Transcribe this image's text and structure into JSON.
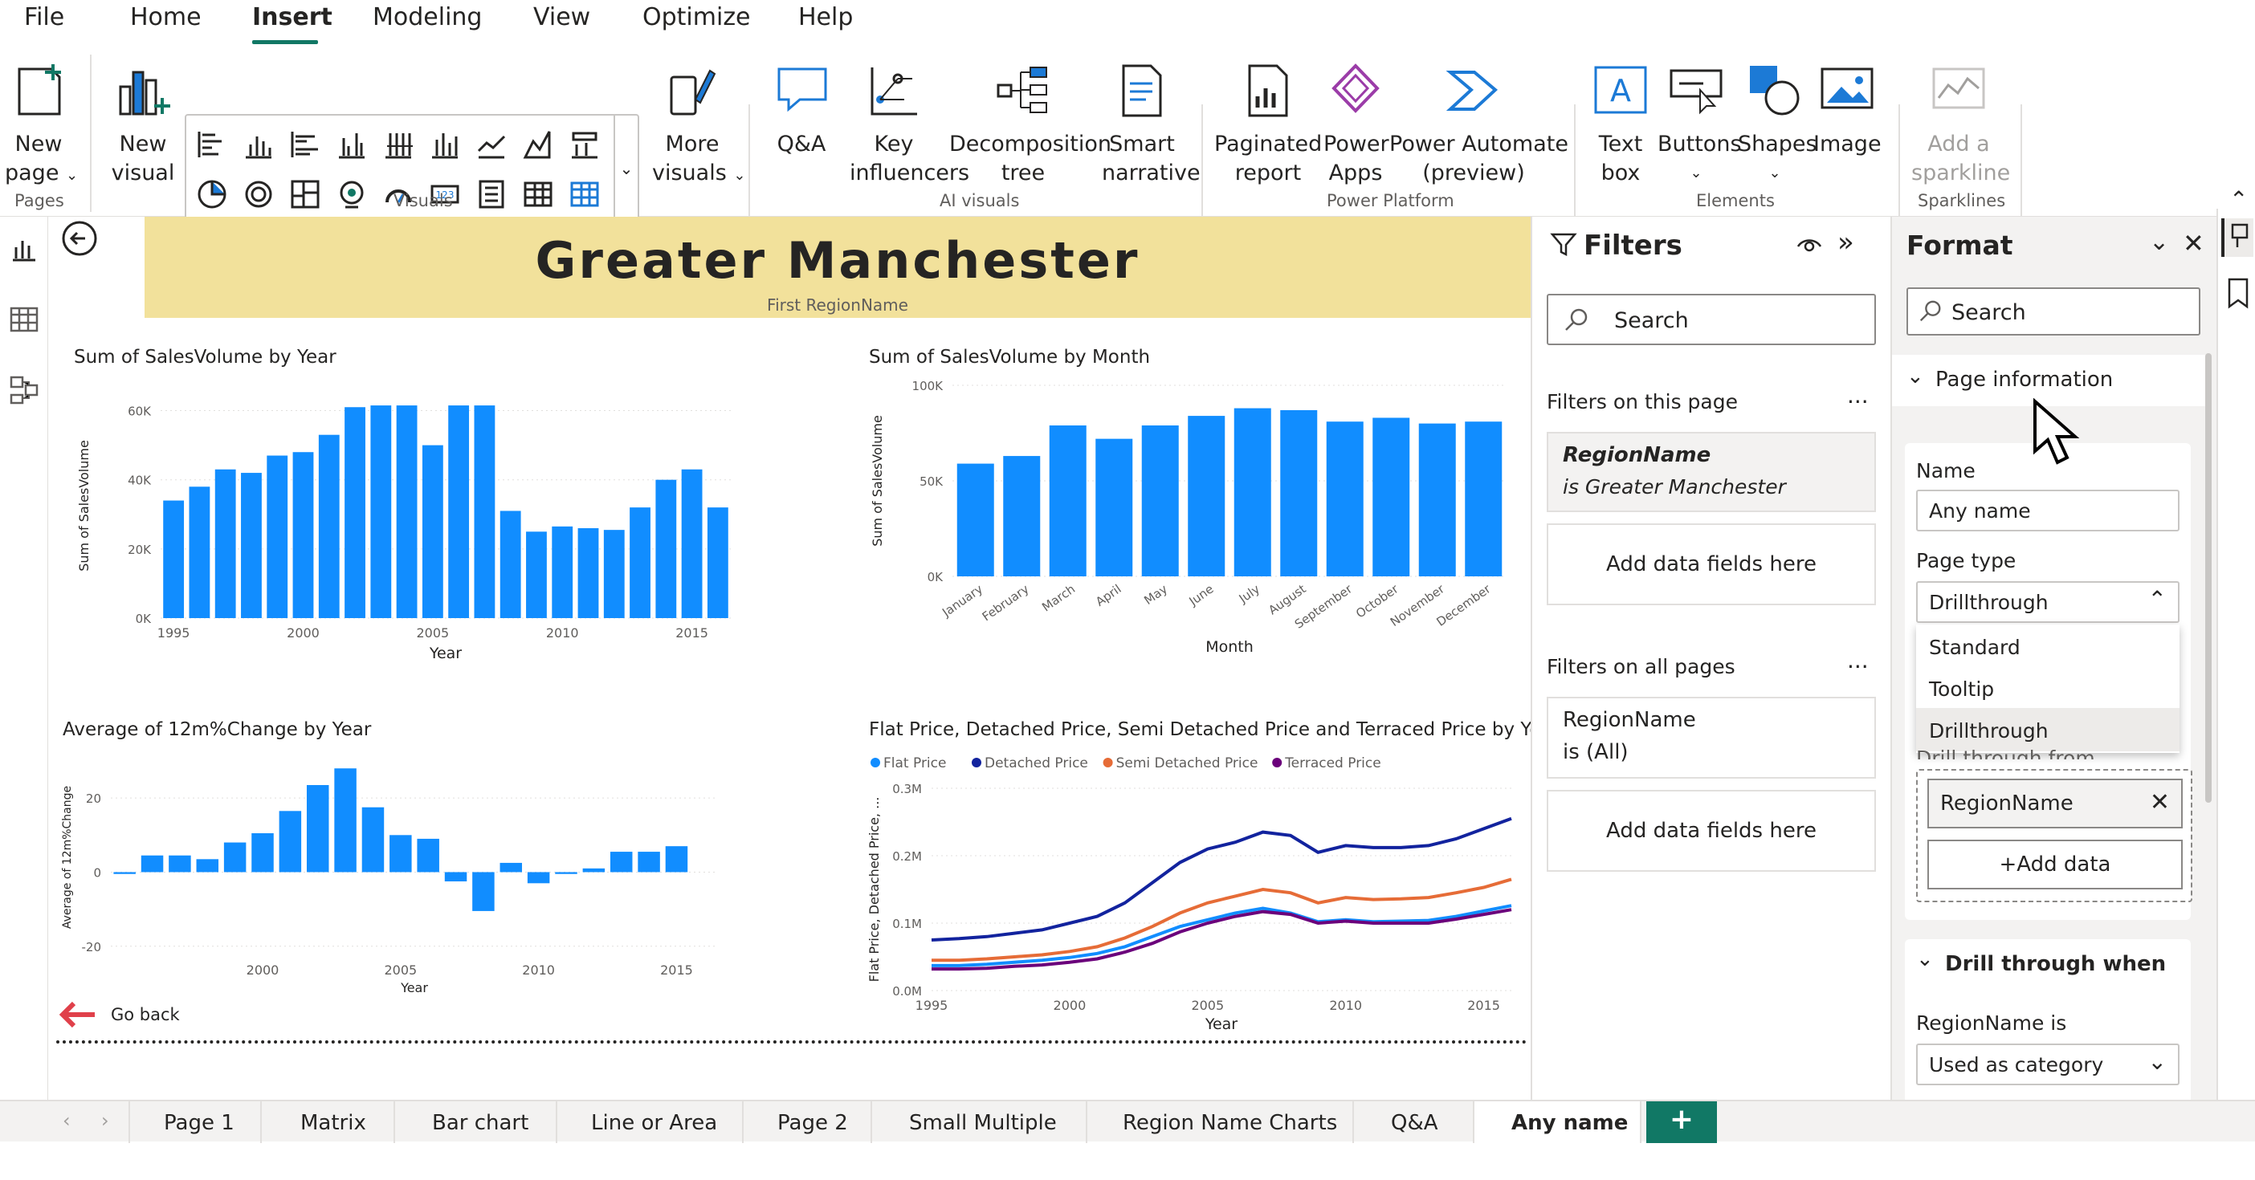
{
  "menu": {
    "items": [
      "File",
      "Home",
      "Insert",
      "Modeling",
      "View",
      "Optimize",
      "Help"
    ],
    "active": "Insert"
  },
  "ribbon": {
    "new_page": {
      "line1": "New",
      "line2": "page"
    },
    "pages_group": "Pages",
    "new_visual": {
      "line1": "New",
      "line2": "visual"
    },
    "visuals_group": "Visuals",
    "more_visuals": {
      "line1": "More",
      "line2": "visuals"
    },
    "qa": "Q&A",
    "key_influencers": {
      "line1": "Key",
      "line2": "influencers"
    },
    "decomp": {
      "line1": "Decomposition",
      "line2": "tree"
    },
    "smart": {
      "line1": "Smart",
      "line2": "narrative"
    },
    "ai_group": "AI visuals",
    "paginated": {
      "line1": "Paginated",
      "line2": "report"
    },
    "power_apps": {
      "line1": "Power",
      "line2": "Apps"
    },
    "power_automate": {
      "line1": "Power Automate",
      "line2": "(preview)"
    },
    "power_group": "Power Platform",
    "text_box": {
      "line1": "Text",
      "line2": "box"
    },
    "buttons": "Buttons",
    "shapes": "Shapes",
    "image": "Image",
    "elements_group": "Elements",
    "sparkline": {
      "line1": "Add a",
      "line2": "sparkline"
    },
    "sparklines_group": "Sparklines"
  },
  "report": {
    "title": "Greater Manchester",
    "subtitle": "First RegionName",
    "go_back": "Go back"
  },
  "chart_data": [
    {
      "type": "bar",
      "title": "Sum of SalesVolume by Year",
      "xlabel": "Year",
      "ylabel": "Sum of SalesVolume",
      "x": [
        1995,
        1996,
        1997,
        1998,
        1999,
        2000,
        2001,
        2002,
        2003,
        2004,
        2005,
        2006,
        2007,
        2008,
        2009,
        2010,
        2011,
        2012,
        2013,
        2014,
        2015,
        2016
      ],
      "values": [
        34000,
        38000,
        43000,
        42000,
        47000,
        48000,
        53000,
        61000,
        61500,
        61500,
        50000,
        61500,
        61500,
        31000,
        25000,
        26500,
        26000,
        25500,
        32000,
        40000,
        43000,
        32000
      ],
      "ylim": [
        0,
        65000
      ],
      "yticks": [
        "0K",
        "20K",
        "40K",
        "60K"
      ],
      "xticks": [
        "1995",
        "2000",
        "2005",
        "2010",
        "2015"
      ],
      "color": "#118dff"
    },
    {
      "type": "bar",
      "title": "Sum of SalesVolume by Month",
      "xlabel": "Month",
      "ylabel": "Sum of SalesVolume",
      "categories": [
        "January",
        "February",
        "March",
        "April",
        "May",
        "June",
        "July",
        "August",
        "September",
        "October",
        "November",
        "December"
      ],
      "values": [
        59000,
        63000,
        79000,
        72000,
        79000,
        84000,
        88000,
        87000,
        81000,
        83000,
        80000,
        81000
      ],
      "ylim": [
        0,
        100000
      ],
      "yticks": [
        "0K",
        "50K",
        "100K"
      ],
      "color": "#118dff"
    },
    {
      "type": "bar",
      "title": "Average of 12m%Change by Year",
      "xlabel": "Year",
      "ylabel": "Average of 12m%Change",
      "x": [
        1995,
        1996,
        1997,
        1998,
        1999,
        2000,
        2001,
        2002,
        2003,
        2004,
        2005,
        2006,
        2007,
        2008,
        2009,
        2010,
        2011,
        2012,
        2013,
        2014,
        2015,
        2016
      ],
      "values": [
        -0.5,
        4.5,
        4.5,
        3.5,
        8,
        10.5,
        16.5,
        23.5,
        28,
        17.5,
        10,
        9,
        -2.5,
        -10.5,
        2.5,
        -3,
        -0.5,
        1,
        5.5,
        5.5,
        7,
        null
      ],
      "ylim": [
        -22,
        30
      ],
      "yticks": [
        "20",
        "0",
        "-20"
      ],
      "xticks": [
        "2000",
        "2005",
        "2010",
        "2015"
      ],
      "color": "#118dff"
    },
    {
      "type": "line",
      "title": "Flat Price, Detached Price, Semi Detached Price and Terraced Price by Year",
      "xlabel": "Year",
      "ylabel": "Flat Price, Detached Price, ...",
      "x": [
        1995,
        1996,
        1997,
        1998,
        1999,
        2000,
        2001,
        2002,
        2003,
        2004,
        2005,
        2006,
        2007,
        2008,
        2009,
        2010,
        2011,
        2012,
        2013,
        2014,
        2015,
        2016
      ],
      "series": [
        {
          "name": "Flat Price",
          "color": "#118dff",
          "values": [
            0.037,
            0.037,
            0.039,
            0.042,
            0.045,
            0.049,
            0.055,
            0.065,
            0.08,
            0.095,
            0.105,
            0.115,
            0.122,
            0.115,
            0.102,
            0.105,
            0.102,
            0.103,
            0.104,
            0.11,
            0.118,
            0.126
          ]
        },
        {
          "name": "Detached Price",
          "color": "#12239e",
          "values": [
            0.075,
            0.077,
            0.08,
            0.085,
            0.09,
            0.1,
            0.11,
            0.13,
            0.16,
            0.19,
            0.21,
            0.22,
            0.235,
            0.23,
            0.205,
            0.215,
            0.212,
            0.212,
            0.215,
            0.225,
            0.24,
            0.255
          ]
        },
        {
          "name": "Semi Detached Price",
          "color": "#e66c37",
          "values": [
            0.045,
            0.045,
            0.047,
            0.05,
            0.053,
            0.058,
            0.065,
            0.078,
            0.095,
            0.115,
            0.13,
            0.14,
            0.15,
            0.145,
            0.13,
            0.138,
            0.135,
            0.136,
            0.138,
            0.145,
            0.153,
            0.165
          ]
        },
        {
          "name": "Terraced Price",
          "color": "#6b007b",
          "values": [
            0.032,
            0.032,
            0.033,
            0.036,
            0.038,
            0.042,
            0.047,
            0.057,
            0.07,
            0.087,
            0.1,
            0.11,
            0.117,
            0.113,
            0.1,
            0.103,
            0.1,
            0.1,
            0.1,
            0.106,
            0.113,
            0.12
          ]
        }
      ],
      "ylim": [
        0,
        0.3
      ],
      "yticks": [
        "0.0M",
        "0.1M",
        "0.2M",
        "0.3M"
      ],
      "xticks": [
        "1995",
        "2000",
        "2005",
        "2010",
        "2015"
      ]
    }
  ],
  "filters": {
    "title": "Filters",
    "search_placeholder": "Search",
    "on_this_page": "Filters on this page",
    "card1": {
      "field": "RegionName",
      "value": "is Greater Manchester"
    },
    "add_fields": "Add data fields here",
    "on_all_pages": "Filters on all pages",
    "card2": {
      "field": "RegionName",
      "value": "is (All)"
    },
    "more": "..."
  },
  "format": {
    "title": "Format",
    "search_placeholder": "Search",
    "page_info": "Page information",
    "name_label": "Name",
    "name_value": "Any name",
    "page_type_label": "Page type",
    "page_type_value": "Drillthrough",
    "options": [
      "Standard",
      "Tooltip",
      "Drillthrough"
    ],
    "drill_from": "Drill through from",
    "drill_field": "RegionName",
    "add_data": "+Add data",
    "drill_when": "Drill through when",
    "region_is": "RegionName is",
    "used_as": "Used as category"
  },
  "tabs": [
    "Page 1",
    "Matrix",
    "Bar chart",
    "Line or Area",
    "Page 2",
    "Small Multiple",
    "Region Name Charts",
    "Q&A",
    "Any name"
  ],
  "active_tab": "Any name"
}
